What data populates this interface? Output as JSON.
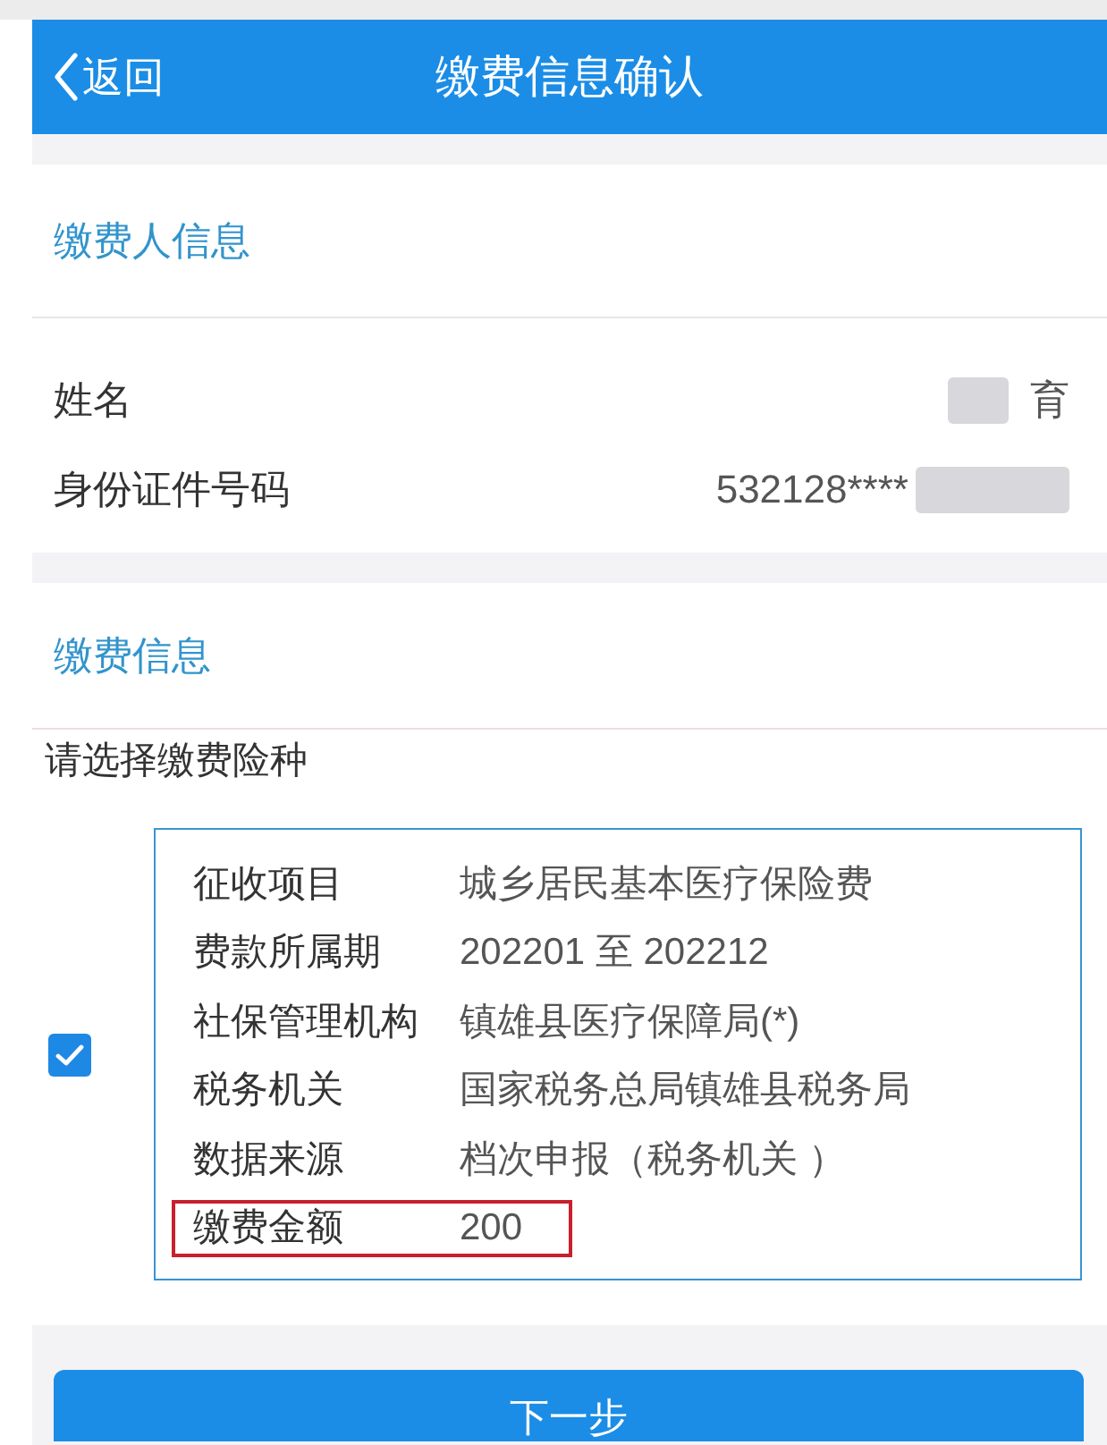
{
  "header": {
    "back_label": "返回",
    "title": "缴费信息确认"
  },
  "payer_section": {
    "title": "缴费人信息",
    "fields": [
      {
        "label": "姓名",
        "value": "育",
        "mask_before": true,
        "mask_after": false
      },
      {
        "label": "身份证件号码",
        "value": "532128****",
        "mask_before": false,
        "mask_after": true
      }
    ]
  },
  "payment_section": {
    "title": "缴费信息",
    "prompt": "请选择缴费险种",
    "items": [
      {
        "checked": true,
        "fields": [
          {
            "label": "征收项目",
            "value": "城乡居民基本医疗保险费",
            "highlighted": false
          },
          {
            "label": "费款所属期",
            "value": "202201 至 202212",
            "highlighted": false
          },
          {
            "label": "社保管理机构",
            "value": "镇雄县医疗保障局(*)",
            "highlighted": false
          },
          {
            "label": "税务机关",
            "value": "国家税务总局镇雄县税务局",
            "highlighted": false
          },
          {
            "label": "数据来源",
            "value": "档次申报（税务机关 ）",
            "highlighted": false
          },
          {
            "label": "缴费金额",
            "value": "200",
            "highlighted": true
          }
        ]
      }
    ]
  },
  "next_button": {
    "label": "下一步"
  }
}
